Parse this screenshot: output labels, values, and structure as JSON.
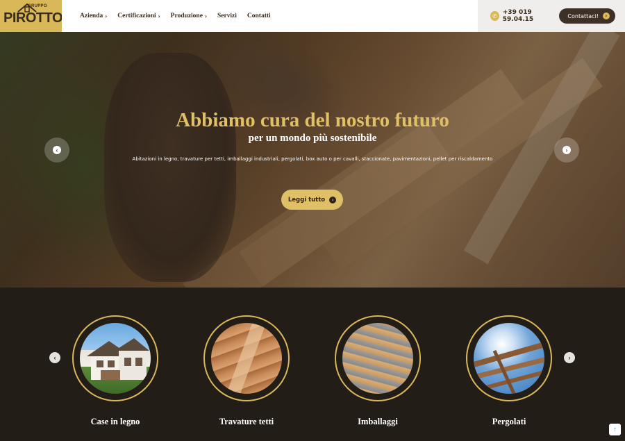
{
  "brand": {
    "logo_small": "GRUPPO",
    "logo_main": "PIROTTO",
    "accent": "#d9b85a",
    "dark": "#231d18"
  },
  "nav": [
    {
      "label": "Azienda",
      "has_submenu": true
    },
    {
      "label": "Certificazioni",
      "has_submenu": true
    },
    {
      "label": "Produzione",
      "has_submenu": true
    },
    {
      "label": "Servizi",
      "has_submenu": false
    },
    {
      "label": "Contatti",
      "has_submenu": false
    }
  ],
  "header": {
    "phone": "+39 019 59.04.15",
    "contact_label": "Contattaci!"
  },
  "hero": {
    "title": "Abbiamo cura del nostro futuro",
    "subtitle": "per un mondo più sostenibile",
    "description": "Abitazioni in legno, travature per tetti, imballaggi industriali, pergolati, box auto o per cavalli,  staccionate, pavimentazioni, pellet per riscaldamento",
    "button_label": "Leggi tutto"
  },
  "categories": [
    {
      "label": "Case in legno"
    },
    {
      "label": "Travature tetti"
    },
    {
      "label": "Imballaggi"
    },
    {
      "label": "Pergolati"
    }
  ],
  "icons": {
    "phone": "phone-icon",
    "arrow_right": "arrow-right-icon",
    "arrow_left": "arrow-left-icon",
    "chevron": "chevron-right-icon",
    "scroll_top": "arrow-up-icon"
  }
}
